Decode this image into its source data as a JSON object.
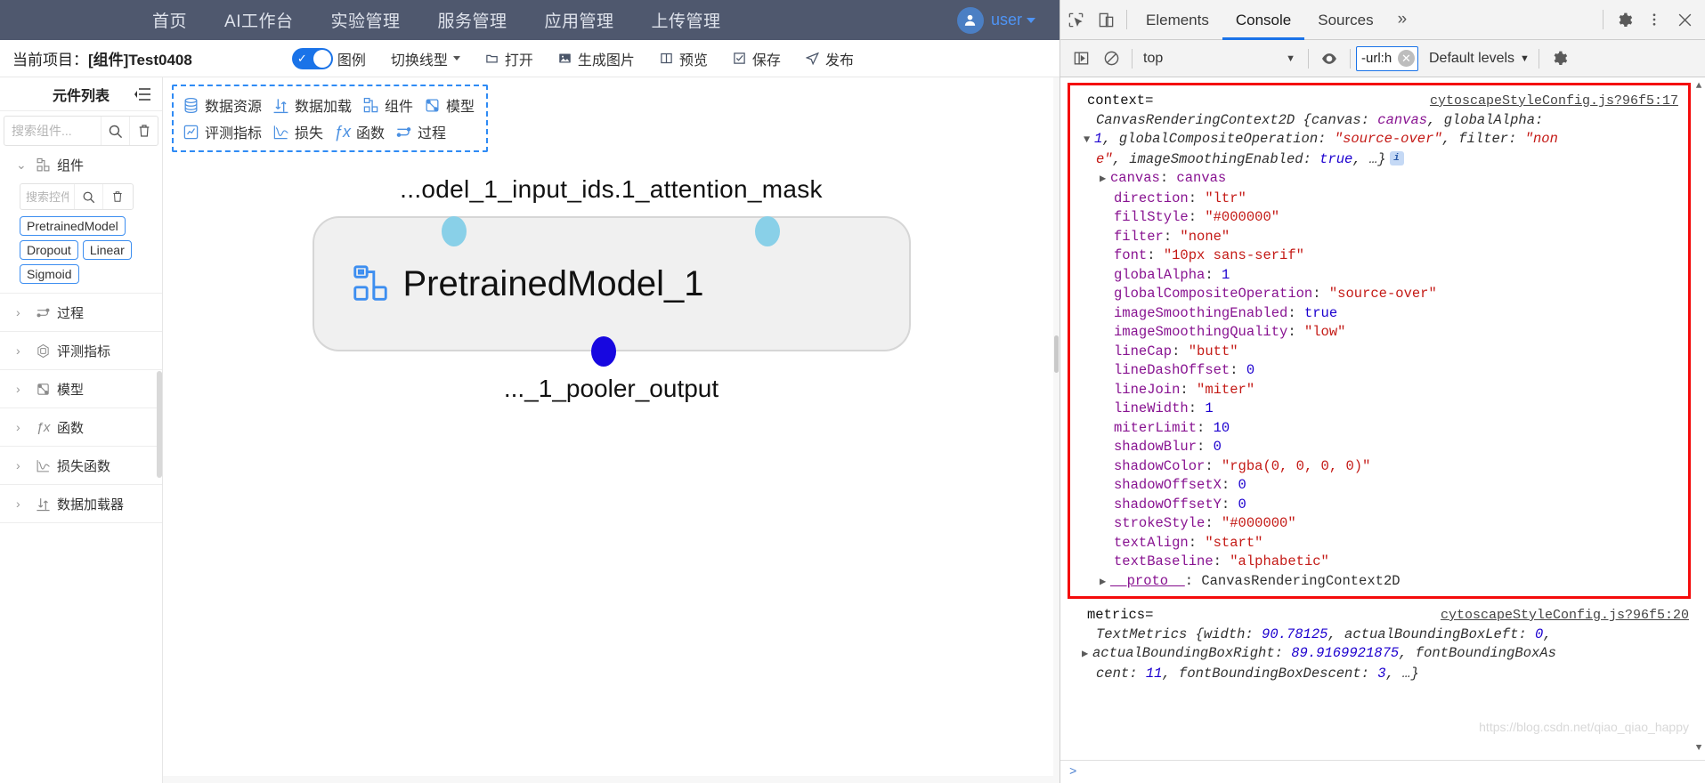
{
  "topnav": {
    "items": [
      {
        "label": "首页",
        "name": "nav-home"
      },
      {
        "label": "AI工作台",
        "name": "nav-ai-workbench"
      },
      {
        "label": "实验管理",
        "name": "nav-experiment-management"
      },
      {
        "label": "服务管理",
        "name": "nav-service-management"
      },
      {
        "label": "应用管理",
        "name": "nav-application-management"
      },
      {
        "label": "上传管理",
        "name": "nav-upload-management"
      }
    ],
    "user": {
      "name": "user",
      "icon": "user-avatar-icon",
      "caret": "chevron-down-icon"
    }
  },
  "projectbar": {
    "prefix": "当前项目：",
    "project": "[组件]Test0408",
    "toggle": {
      "label": "图例",
      "on": true,
      "check": "✓"
    },
    "line_type": {
      "label": "切换线型"
    },
    "actions": [
      {
        "label": "打开",
        "icon": "folder-icon"
      },
      {
        "label": "生成图片",
        "icon": "image-icon"
      },
      {
        "label": "预览",
        "icon": "book-icon"
      },
      {
        "label": "保存",
        "icon": "check-square-icon"
      },
      {
        "label": "发布",
        "icon": "send-icon"
      }
    ]
  },
  "sidebar": {
    "title": "元件列表",
    "collapse_icon": "collapse-panel-icon",
    "search": {
      "placeholder": "搜索组件...",
      "value": "",
      "search_icon": "search-icon",
      "delete_icon": "trash-icon"
    },
    "groups": [
      {
        "label": "组件",
        "icon": "component-icon",
        "expanded": true,
        "chevron": "chevron-down-icon",
        "sub_search": {
          "placeholder": "搜索控件",
          "value": "",
          "search_icon": "search-icon",
          "delete_icon": "trash-icon"
        },
        "chips": [
          "PretrainedModel",
          "Dropout",
          "Linear",
          "Sigmoid"
        ]
      },
      {
        "label": "过程",
        "icon": "process-icon",
        "expanded": false,
        "chevron": "chevron-right-icon"
      },
      {
        "label": "评测指标",
        "icon": "metrics-icon",
        "expanded": false,
        "chevron": "chevron-right-icon"
      },
      {
        "label": "模型",
        "icon": "model-icon",
        "expanded": false,
        "chevron": "chevron-right-icon"
      },
      {
        "label": "函数",
        "icon": "function-icon",
        "expanded": false,
        "chevron": "chevron-right-icon"
      },
      {
        "label": "损失函数",
        "icon": "loss-icon",
        "expanded": false,
        "chevron": "chevron-right-icon"
      },
      {
        "label": "数据加载器",
        "icon": "dataloader-icon",
        "expanded": false,
        "chevron": "chevron-right-icon"
      }
    ]
  },
  "palette": {
    "items": [
      {
        "label": "数据资源",
        "icon": "database-icon"
      },
      {
        "label": "数据加载",
        "icon": "dataloader-icon"
      },
      {
        "label": "组件",
        "icon": "component-icon"
      },
      {
        "label": "模型",
        "icon": "model-icon"
      },
      {
        "label": "评测指标",
        "icon": "metrics-icon"
      },
      {
        "label": "损失",
        "icon": "loss-icon"
      },
      {
        "label": "函数",
        "icon": "function-icon"
      },
      {
        "label": "过程",
        "icon": "process-icon"
      }
    ]
  },
  "graph": {
    "input_label": "...odel_1_input_ids.1_attention_mask",
    "node_title": "PretrainedModel_1",
    "node_icon": "component-icon",
    "output_label": "..._1_pooler_output",
    "ports": {
      "input_color": "#89d0e8",
      "output_color": "#1707e0"
    }
  },
  "devtools": {
    "toolbar": {
      "inspect_icon": "inspect-element-icon",
      "device_icon": "device-toolbar-icon",
      "tabs": [
        {
          "label": "Elements",
          "active": false
        },
        {
          "label": "Console",
          "active": true
        },
        {
          "label": "Sources",
          "active": false
        }
      ],
      "more": "»",
      "settings_icon": "gear-icon",
      "menu_icon": "kebab-menu-icon",
      "close_icon": "close-icon"
    },
    "filterbar": {
      "sidebar_icon": "console-sidebar-icon",
      "clear_icon": "clear-console-icon",
      "context": "top",
      "context_caret": "▼",
      "eye_icon": "live-expression-icon",
      "filter_value": "-url:h",
      "filter_clear": "✕",
      "levels": "Default levels",
      "levels_caret": "▼",
      "settings_icon": "gear-icon"
    },
    "console": {
      "entry1": {
        "name": "context=",
        "source": "cytoscapeStyleConfig.js?96f5:17",
        "summary": {
          "type": "CanvasRenderingContext2D",
          "open_brace": " {",
          "p1_key": "canvas: ",
          "p1_val": "canvas",
          "p2_key": ", globalAlpha: ",
          "p2_val": "1",
          "p3_key": ", globalCompositeOperation: ",
          "p3_val": "\"source-over\"",
          "p4_key": ", filter: ",
          "p4_val": "\"none\"",
          "p5_key": ", imageSmoothingEnabled: ",
          "p5_val": "true",
          "tail": ", …}",
          "badge": "i"
        },
        "props": [
          {
            "key": "canvas",
            "value": "canvas",
            "vtype": "obj",
            "expandable": true,
            "tri": "▶"
          },
          {
            "key": "direction",
            "value": "\"ltr\"",
            "vtype": "str"
          },
          {
            "key": "fillStyle",
            "value": "\"#000000\"",
            "vtype": "str"
          },
          {
            "key": "filter",
            "value": "\"none\"",
            "vtype": "str"
          },
          {
            "key": "font",
            "value": "\"10px sans-serif\"",
            "vtype": "str"
          },
          {
            "key": "globalAlpha",
            "value": "1",
            "vtype": "num"
          },
          {
            "key": "globalCompositeOperation",
            "value": "\"source-over\"",
            "vtype": "str"
          },
          {
            "key": "imageSmoothingEnabled",
            "value": "true",
            "vtype": "num"
          },
          {
            "key": "imageSmoothingQuality",
            "value": "\"low\"",
            "vtype": "str"
          },
          {
            "key": "lineCap",
            "value": "\"butt\"",
            "vtype": "str"
          },
          {
            "key": "lineDashOffset",
            "value": "0",
            "vtype": "num"
          },
          {
            "key": "lineJoin",
            "value": "\"miter\"",
            "vtype": "str"
          },
          {
            "key": "lineWidth",
            "value": "1",
            "vtype": "num"
          },
          {
            "key": "miterLimit",
            "value": "10",
            "vtype": "num"
          },
          {
            "key": "shadowBlur",
            "value": "0",
            "vtype": "num"
          },
          {
            "key": "shadowColor",
            "value": "\"rgba(0, 0, 0, 0)\"",
            "vtype": "str"
          },
          {
            "key": "shadowOffsetX",
            "value": "0",
            "vtype": "num"
          },
          {
            "key": "shadowOffsetY",
            "value": "0",
            "vtype": "num"
          },
          {
            "key": "strokeStyle",
            "value": "\"#000000\"",
            "vtype": "str"
          },
          {
            "key": "textAlign",
            "value": "\"start\"",
            "vtype": "str"
          },
          {
            "key": "textBaseline",
            "value": "\"alphabetic\"",
            "vtype": "str"
          },
          {
            "key": "__proto__",
            "value": "CanvasRenderingContext2D",
            "vtype": "proto",
            "expandable": true,
            "tri": "▶"
          }
        ]
      },
      "entry2": {
        "name": "metrics=",
        "source": "cytoscapeStyleConfig.js?96f5:20",
        "tri": "▶",
        "line1": "TextMetrics {width: 90.78125, actualBoundingBoxLeft: 0,",
        "line2": "actualBoundingBoxRight: 89.9169921875, fontBoundingBoxAs",
        "line3": "cent: 11, fontBoundingBoxDescent: 3, …}",
        "v1": "90.78125",
        "v2": "0",
        "v3": "89.9169921875",
        "v4": "11",
        "v5": "3"
      },
      "watermark": "https://blog.csdn.net/qiao_qiao_happy",
      "scroll_up": "▲",
      "scroll_down": "▼",
      "prompt": ">"
    }
  },
  "colors": {
    "navbar_bg": "#4f586e",
    "accent_blue": "#1a73e8",
    "red_highlight": "#f40b0b",
    "port_in": "#89d0e8",
    "port_out": "#1707e0"
  }
}
